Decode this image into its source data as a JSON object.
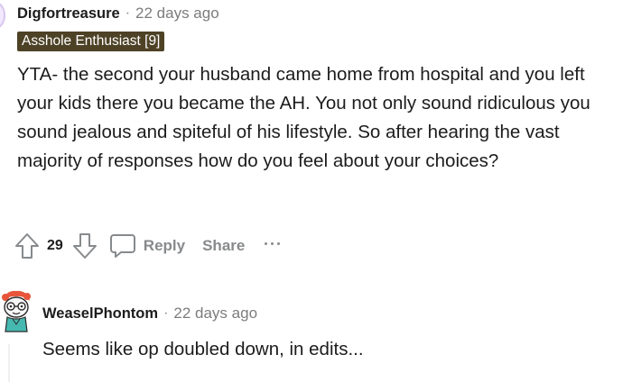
{
  "top_comment": {
    "author": "Digfortreasure",
    "separator": "·",
    "timestamp": "22 days ago",
    "flair": "Asshole Enthusiast [9]",
    "body": "YTA- the second your husband came home from hospital and you left your kids there you became the AH. You not only sound ridiculous you sound jealous and spiteful of his lifestyle. So after hearing the vast majority of responses how do you feel about your choices?",
    "votes": "29",
    "reply_label": "Reply",
    "share_label": "Share"
  },
  "reply_comment": {
    "author": "WeaselPhontom",
    "separator": "·",
    "timestamp": "22 days ago",
    "body": "Seems like op doubled down, in edits..."
  },
  "icons": {
    "upvote": "arrow-up-outline-icon",
    "downvote": "arrow-down-outline-icon",
    "reply": "speech-bubble-icon",
    "more": "three-dots-icon"
  },
  "colors": {
    "flair_bg": "#4e4226",
    "muted_text": "#878a8c",
    "text": "#1c1c1c"
  }
}
